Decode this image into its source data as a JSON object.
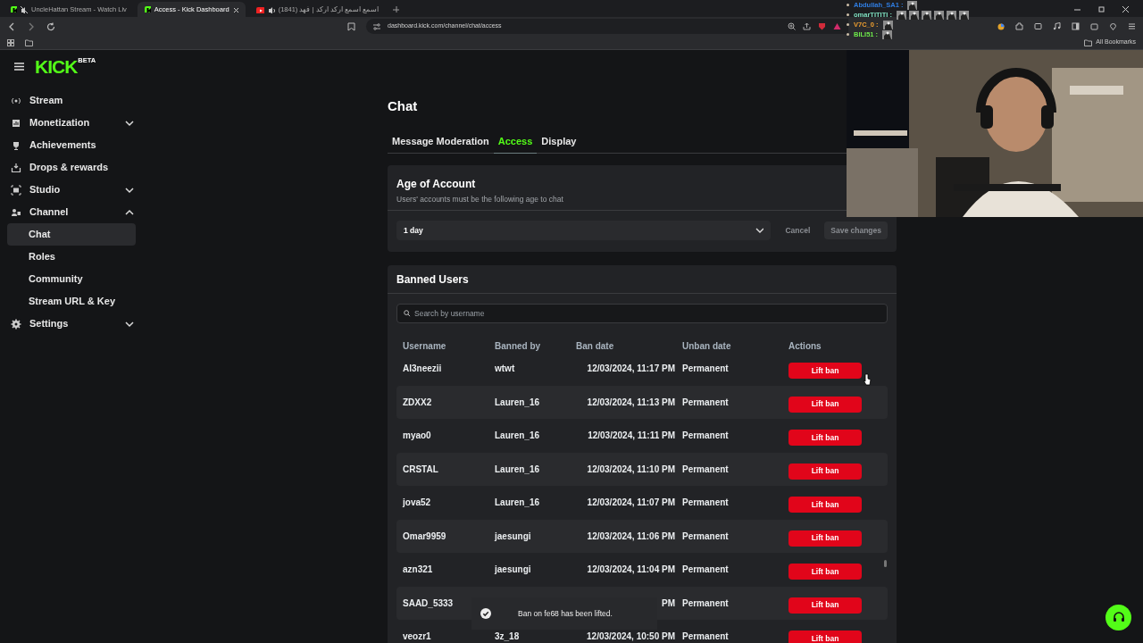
{
  "browser": {
    "tabs": [
      {
        "title": "UncleHattan Stream - Watch Liv",
        "selected": false
      },
      {
        "title": "Access - Kick Dashboard",
        "selected": true
      },
      {
        "title": "(1841) اسمع اسمع اركد اركد | فهد",
        "selected": false
      }
    ],
    "url": "dashboard.kick.com/channel/chat/access",
    "bookmarks": "All Bookmarks"
  },
  "stream_chat": [
    {
      "user": "Abdullah_SA1 :",
      "color": "#2f7de1"
    },
    {
      "user": "omarTITITI :",
      "color": "#7fe0c0"
    },
    {
      "user": "V7C_0 :",
      "color": "#f0a030"
    },
    {
      "user": "BILI51 :",
      "color": "#6de84a"
    }
  ],
  "sidebar": {
    "logo": "KICK",
    "logo_badge": "BETA",
    "items": [
      {
        "label": "Stream"
      },
      {
        "label": "Monetization",
        "expanded": false
      },
      {
        "label": "Achievements"
      },
      {
        "label": "Drops & rewards"
      },
      {
        "label": "Studio",
        "expanded": false
      },
      {
        "label": "Channel",
        "expanded": true,
        "children": [
          {
            "label": "Chat",
            "selected": true
          },
          {
            "label": "Roles",
            "selected": false
          },
          {
            "label": "Community",
            "selected": false
          },
          {
            "label": "Stream URL & Key",
            "selected": false
          }
        ]
      },
      {
        "label": "Settings",
        "expanded": false
      }
    ]
  },
  "page_title": "Chat",
  "tabs": [
    {
      "label": "Message Moderation",
      "selected": false
    },
    {
      "label": "Access",
      "selected": true
    },
    {
      "label": "Display",
      "selected": false
    }
  ],
  "age_of_account": {
    "title": "Age of Account",
    "subtitle": "Users' accounts must be the following age to chat",
    "value": "1 day",
    "buttons": [
      {
        "label": "Cancel",
        "kind": "ghost",
        "disabled": true
      },
      {
        "label": "Save changes",
        "kind": "solid",
        "disabled": true
      }
    ]
  },
  "banned_users": {
    "title": "Banned Users",
    "search": {
      "placeholder": "Search by username"
    },
    "columns": [
      "Username",
      "Banned by",
      "Ban date",
      "Unban date",
      "Actions"
    ],
    "rows": [
      {
        "username": "Al3neezii",
        "banned_by": "wtwt",
        "ban_date": "12/03/2024, 11:17 PM",
        "unban_date": "Permanent",
        "action": "Lift ban"
      },
      {
        "username": "ZDXX2",
        "banned_by": "Lauren_16",
        "ban_date": "12/03/2024, 11:13 PM",
        "unban_date": "Permanent",
        "action": "Lift ban"
      },
      {
        "username": "myao0",
        "banned_by": "Lauren_16",
        "ban_date": "12/03/2024, 11:11 PM",
        "unban_date": "Permanent",
        "action": "Lift ban"
      },
      {
        "username": "CRSTAL",
        "banned_by": "Lauren_16",
        "ban_date": "12/03/2024, 11:10 PM",
        "unban_date": "Permanent",
        "action": "Lift ban"
      },
      {
        "username": "jova52",
        "banned_by": "Lauren_16",
        "ban_date": "12/03/2024, 11:07 PM",
        "unban_date": "Permanent",
        "action": "Lift ban"
      },
      {
        "username": "Omar9959",
        "banned_by": "jaesungi",
        "ban_date": "12/03/2024, 11:06 PM",
        "unban_date": "Permanent",
        "action": "Lift ban"
      },
      {
        "username": "azn321",
        "banned_by": "jaesungi",
        "ban_date": "12/03/2024, 11:04 PM",
        "unban_date": "Permanent",
        "action": "Lift ban"
      },
      {
        "username": "SAAD_5333",
        "ban_date": "PM",
        "unban_date": "Permanent",
        "action": "Lift ban"
      },
      {
        "username": "veozr1",
        "banned_by": "3z_18",
        "ban_date": "12/03/2024, 10:50 PM",
        "unban_date": "Permanent",
        "action": "Lift ban"
      }
    ]
  },
  "toast": {
    "message": "Ban on fe68 has been lifted."
  }
}
